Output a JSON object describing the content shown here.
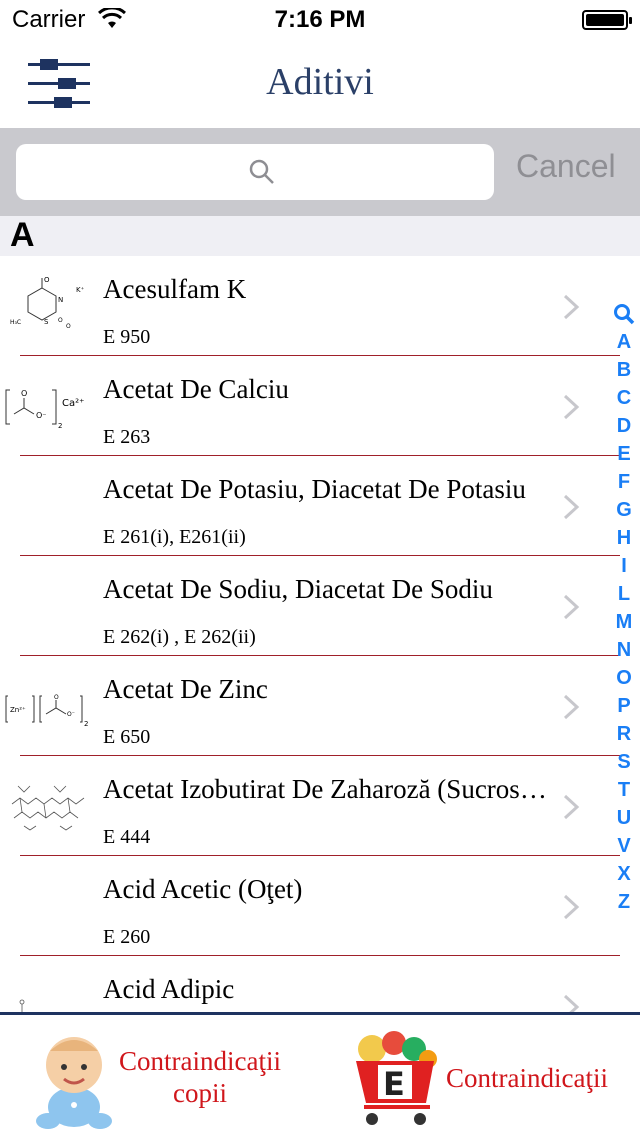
{
  "status": {
    "carrier": "Carrier",
    "time": "7:16 PM"
  },
  "nav": {
    "title": "Aditivi",
    "menu_icon": "sliders-icon"
  },
  "search": {
    "placeholder": "",
    "cancel_label": "Cancel"
  },
  "section": {
    "letter": "A"
  },
  "items": [
    {
      "name": "Acesulfam K",
      "code": "E 950",
      "thumb": "acesulfam-structure"
    },
    {
      "name": "Acetat De Calciu",
      "code": "E 263",
      "thumb": "calcium-acetate-structure"
    },
    {
      "name": "Acetat De Potasiu, Diacetat De Potasiu",
      "code": "E 261(i),  E261(ii)",
      "thumb": ""
    },
    {
      "name": "Acetat De Sodiu,  Diacetat De Sodiu",
      "code": "E 262(i) , E 262(ii)",
      "thumb": ""
    },
    {
      "name": "Acetat De Zinc",
      "code": "E 650",
      "thumb": "zinc-acetate-structure"
    },
    {
      "name": "Acetat Izobutirat De Zaharoză (Sucrose Acetate Isobutyrate)",
      "code": "E 444",
      "thumb": "sucrose-structure"
    },
    {
      "name": "Acid Acetic (Oţet)",
      "code": "E 260",
      "thumb": ""
    },
    {
      "name": "Acid Adipic",
      "code": "",
      "thumb": "adipic-structure"
    }
  ],
  "index": [
    "Q",
    "A",
    "B",
    "C",
    "D",
    "E",
    "F",
    "G",
    "H",
    "I",
    "L",
    "M",
    "N",
    "O",
    "P",
    "R",
    "S",
    "T",
    "U",
    "V",
    "X",
    "Z"
  ],
  "bottom": {
    "copii_line1": "Contraindicaţii",
    "copii_line2": "copii",
    "contra_label": "Contraindicaţii"
  },
  "colors": {
    "accent": "#2b4068",
    "index": "#1a7ef5",
    "separator": "#a0202a",
    "button_text": "#d0161b"
  }
}
